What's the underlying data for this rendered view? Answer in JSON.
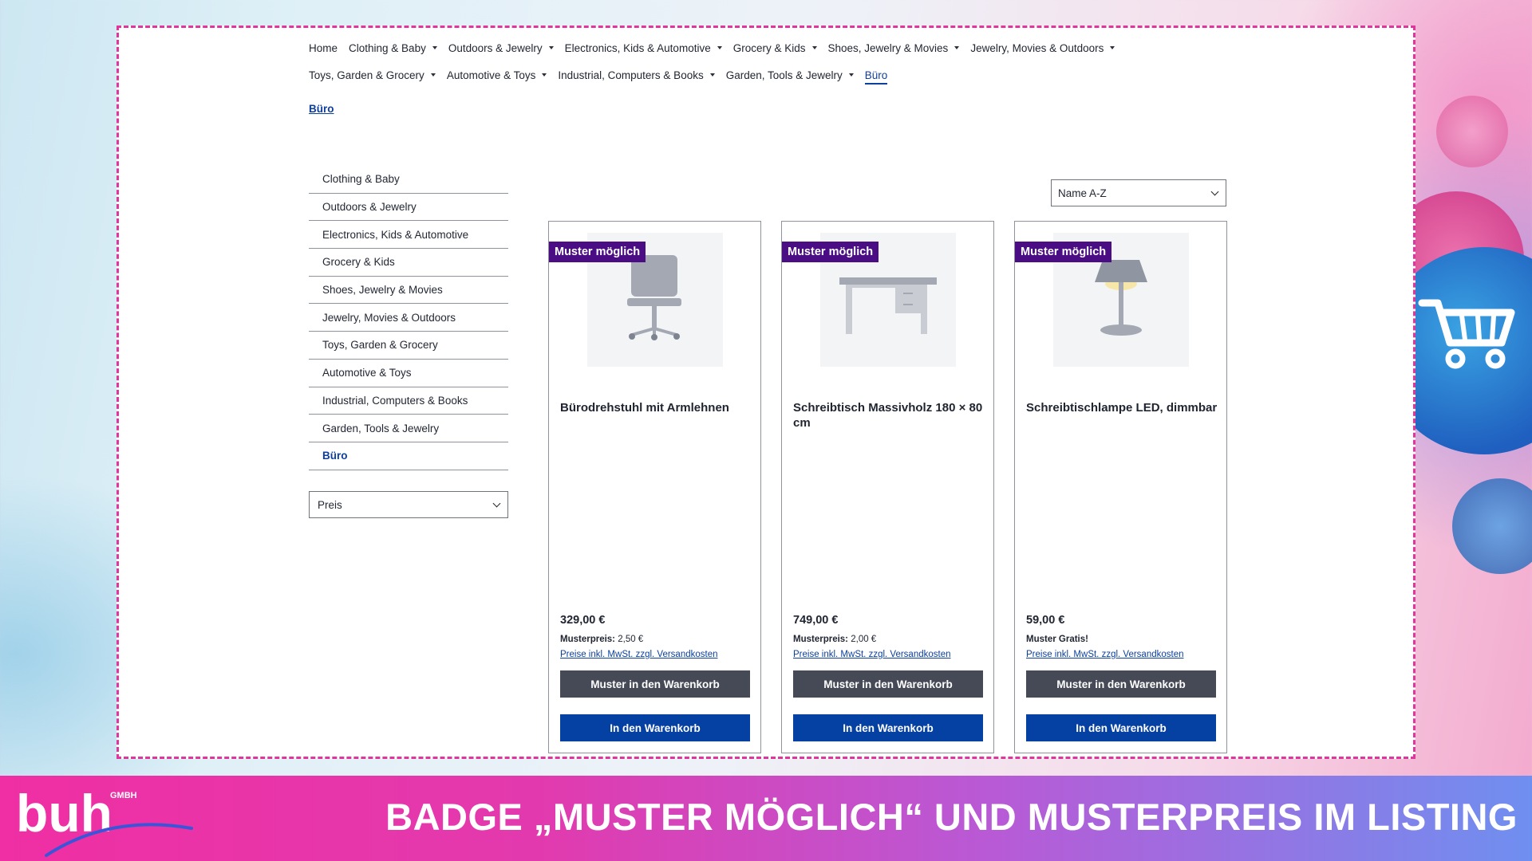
{
  "nav": {
    "row1": [
      {
        "label": "Home",
        "dropdown": false
      },
      {
        "label": "Clothing & Baby",
        "dropdown": true
      },
      {
        "label": "Outdoors & Jewelry",
        "dropdown": true
      },
      {
        "label": "Electronics, Kids & Automotive",
        "dropdown": true
      },
      {
        "label": "Grocery & Kids",
        "dropdown": true
      },
      {
        "label": "Shoes, Jewelry & Movies",
        "dropdown": true
      },
      {
        "label": "Jewelry, Movies & Outdoors",
        "dropdown": true
      }
    ],
    "row2": [
      {
        "label": "Toys, Garden & Grocery",
        "dropdown": true
      },
      {
        "label": "Automotive & Toys",
        "dropdown": true
      },
      {
        "label": "Industrial, Computers & Books",
        "dropdown": true
      },
      {
        "label": "Garden, Tools & Jewelry",
        "dropdown": true
      },
      {
        "label": "Büro",
        "dropdown": false,
        "active": true
      }
    ]
  },
  "breadcrumb": "Büro",
  "sidebar": {
    "items": [
      {
        "label": "Clothing & Baby"
      },
      {
        "label": "Outdoors & Jewelry"
      },
      {
        "label": "Electronics, Kids & Automotive"
      },
      {
        "label": "Grocery & Kids"
      },
      {
        "label": "Shoes, Jewelry & Movies"
      },
      {
        "label": "Jewelry, Movies & Outdoors"
      },
      {
        "label": "Toys, Garden & Grocery"
      },
      {
        "label": "Automotive & Toys"
      },
      {
        "label": "Industrial, Computers & Books"
      },
      {
        "label": "Garden, Tools & Jewelry"
      },
      {
        "label": "Büro",
        "active": true
      }
    ],
    "filter_label": "Preis"
  },
  "sort": {
    "selected": "Name A-Z"
  },
  "products": [
    {
      "badge": "Muster möglich",
      "name": "Bürodrehstuhl mit Armlehnen",
      "price": "329,00 €",
      "sample_label": "Musterpreis:",
      "sample_value": "2,50 €",
      "tax_note": "Preise inkl. MwSt. zzgl. Versandkosten",
      "sample_button": "Muster in den Warenkorb",
      "cart_button": "In den Warenkorb",
      "icon": "office-chair-icon"
    },
    {
      "badge": "Muster möglich",
      "name": "Schreibtisch Massivholz 180 × 80 cm",
      "price": "749,00 €",
      "sample_label": "Musterpreis:",
      "sample_value": "2,00 €",
      "tax_note": "Preise inkl. MwSt. zzgl. Versandkosten",
      "sample_button": "Muster in den Warenkorb",
      "cart_button": "In den Warenkorb",
      "icon": "desk-icon"
    },
    {
      "badge": "Muster möglich",
      "name": "Schreibtischlampe LED, dimmbar",
      "price": "59,00 €",
      "sample_label": "Muster Gratis!",
      "sample_value": "",
      "tax_note": "Preise inkl. MwSt. zzgl. Versandkosten",
      "sample_button": "Muster in den Warenkorb",
      "cart_button": "In den Warenkorb",
      "icon": "desk-lamp-icon"
    }
  ],
  "footer": {
    "logo_text": "buh",
    "logo_suffix": "GMBH",
    "headline": "BADGE „MUSTER MÖGLICH“ UND MUSTERPREIS IM LISTING"
  },
  "colors": {
    "badge": "#4a0d84",
    "primary_button": "#0540a3",
    "sample_button": "#464a57",
    "link": "#0d3f9e",
    "frame_border": "#e0359b"
  }
}
